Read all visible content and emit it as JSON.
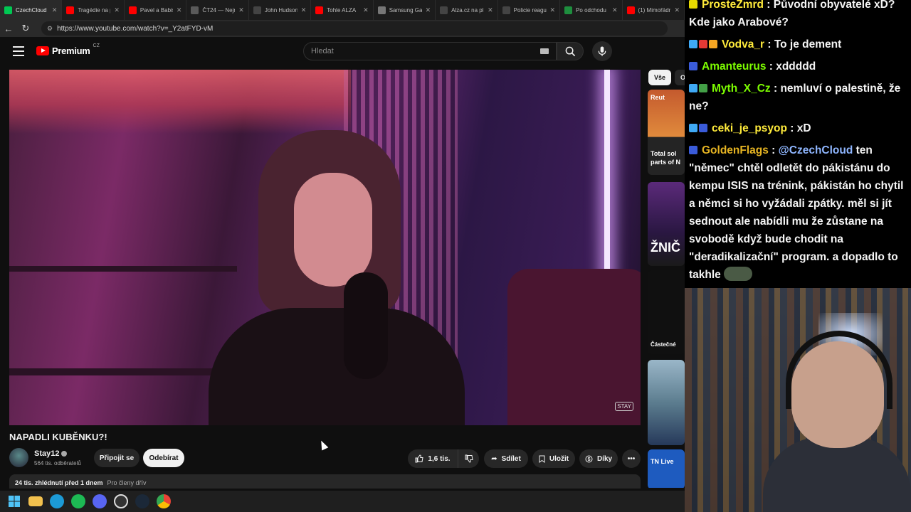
{
  "browser": {
    "tabs": [
      {
        "label": "CzechCloud",
        "icon": "twitch-icon",
        "color": "#00c853"
      },
      {
        "label": "Tragédie na p",
        "icon": "youtube-icon",
        "color": "#ff0000"
      },
      {
        "label": "Pavel a Babiš",
        "icon": "youtube-icon",
        "color": "#ff0000"
      },
      {
        "label": "ČT24 — Nejn",
        "icon": "news-icon",
        "color": "#5a5a5a"
      },
      {
        "label": "John Hudson",
        "icon": "x-icon",
        "color": "#222"
      },
      {
        "label": "Tohle ALZA",
        "icon": "youtube-icon",
        "color": "#ff0000"
      },
      {
        "label": "Samsung Gal",
        "icon": "shop-icon",
        "color": "#777"
      },
      {
        "label": "Alza.cz na pl",
        "icon": "x-icon",
        "color": "#222"
      },
      {
        "label": "Policie reagu",
        "icon": "x-icon",
        "color": "#222"
      },
      {
        "label": "Po odchodu",
        "icon": "doc-icon",
        "color": "#1e8e3e"
      },
      {
        "label": "(1) Mimořádn",
        "icon": "youtube-icon",
        "color": "#ff0000"
      }
    ],
    "url": "https://www.youtube.com/watch?v=_Y2atFYD-vM"
  },
  "youtube": {
    "brand": "Premium",
    "region": "CZ",
    "search_placeholder": "Hledat",
    "video": {
      "title": "NAPADLI KUBĚNKU?!",
      "channel": "Stay12",
      "subscribers": "564 tis. odběratelů",
      "watermark": "STAY"
    },
    "actions": {
      "join": "Připojit se",
      "subscribe": "Odebírat",
      "likes": "1,6 tis.",
      "share": "Sdílet",
      "save": "Uložit",
      "thanks": "Díky"
    },
    "description": {
      "views": "24 tis. zhlédnutí  před 1 dnem",
      "members": "Pro členy dřív"
    },
    "recs": {
      "chip_all": "Vše",
      "chip_other": "O",
      "items": [
        {
          "label": "Reut",
          "caption": "Total sol parts of N"
        },
        {
          "label": "ŽNIČ"
        },
        {
          "label": "Částečné"
        },
        {
          "label": ""
        },
        {
          "label": "TN Live"
        }
      ]
    }
  },
  "chat": {
    "messages": [
      {
        "user": "ProsteZmrd",
        "user_color": "#ffeb3b",
        "text": "Původní obyvatelé xD? Kde jako Arabové?"
      },
      {
        "user": "Vodva_r",
        "user_color": "#ffeb3b",
        "text": "To je dement"
      },
      {
        "user": "Amanteurus",
        "user_color": "#7cfc00",
        "text": "xddddd"
      },
      {
        "user": "Myth_X_Cz",
        "user_color": "#7cfc00",
        "text": "nemluví o palestině, že ne?"
      },
      {
        "user": "ceki_je_psyop",
        "user_color": "#ffeb3b",
        "text": "xD"
      },
      {
        "user": "GoldenFlags",
        "user_color": "#e6b422",
        "mention": "@CzechCloud",
        "text": "ten \"němec\" chtěl odletět do pákistánu do kempu ISIS na trénink, pákistán ho chytil a němci si ho vyžádali zpátky. měl si jít sednout ale nabídli mu že zůstane na svobodě když bude chodit na \"deradikalizační\" program. a dopadlo to takhle"
      }
    ]
  },
  "taskbar": {
    "icons": [
      "windows-icon",
      "folder-icon",
      "edge-icon",
      "spotify-icon",
      "discord-icon",
      "obs-icon",
      "steam-icon",
      "chrome-icon"
    ]
  }
}
